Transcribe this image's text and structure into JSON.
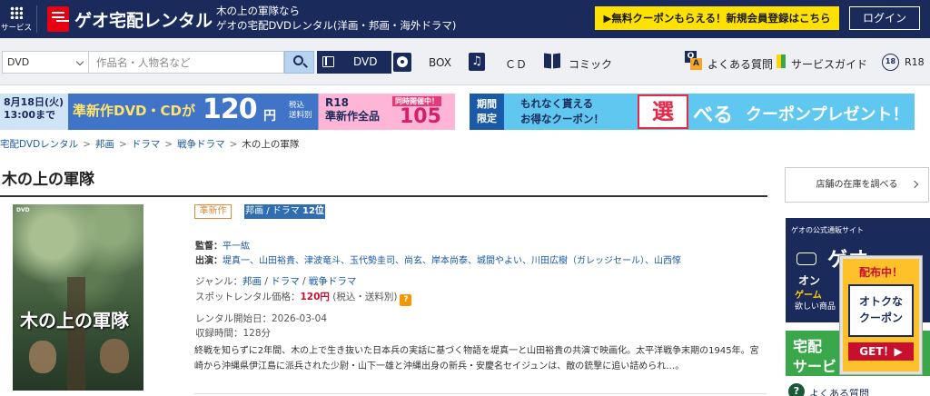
{
  "header": {
    "service_label": "サービス",
    "logo_text": "ゲオ宅配レンタル",
    "tagline_line1": "木の上の軍隊なら",
    "tagline_line2": "ゲオの宅配DVDレンタル(洋画・邦画・海外ドラマ)",
    "promo_label": "▶無料クーポンもらえる！新規会員登録はこちら",
    "login_label": "ログイン",
    "brand_color": "#1a2a5a",
    "promo_color": "#ffe100"
  },
  "nav": {
    "category_value": "DVD",
    "search_placeholder": "作品名・人物名など",
    "tabs": [
      {
        "label": "DVD",
        "icon": "film-icon",
        "active": true
      },
      {
        "label": "BOX",
        "icon": "disc-icon"
      },
      {
        "label": "ＣＤ",
        "icon": "music-note-icon"
      },
      {
        "label": "コミック",
        "icon": "book-icon"
      }
    ],
    "faq_label": "よくある質問",
    "guide_label": "サービスガイド",
    "r18_label": "R18",
    "r18_icon_text": "18"
  },
  "banner1": {
    "date_line1": "8月18日(火)",
    "date_line2": "13:00まで",
    "main_text": "準新作DVD・CDが",
    "price": "120",
    "yen": "円",
    "tax_line1": "税込",
    "tax_line2": "送料別",
    "simul_label": "同時開催中！",
    "r18_line1": "R18",
    "r18_line2": "準新作全品",
    "r18_price": "105円"
  },
  "banner2": {
    "limit_line1": "期間",
    "limit_line2": "限定",
    "text_line1": "もれなく貰える",
    "text_line2": "お得なクーポン！",
    "choose_char": "選",
    "beru": "べる",
    "cp_text": "クーポンプレゼント！"
  },
  "breadcrumb": {
    "items": [
      "宅配DVDレンタル",
      "邦画",
      "ドラマ",
      "戦争ドラマ"
    ],
    "current": "木の上の軍隊",
    "separator": ">"
  },
  "product": {
    "title": "木の上の軍隊",
    "poster_title": "木の上の軍隊",
    "poster_corner": "DVD",
    "badge_new": "準新作",
    "badge_rank_genre": "邦画 / ドラマ",
    "badge_rank_num": "12位",
    "director_label": "監督：",
    "director": "平一紘",
    "cast_label": "出演：",
    "cast": "堤真一、山田裕貴、津波竜斗、玉代勢圭司、尚玄、岸本尚泰、城間やよい、川田広樹（ガレッジセール）、山西惇",
    "genre_label": "ジャンル：",
    "genre_values": [
      "邦画",
      "ドラマ",
      "戦争ドラマ"
    ],
    "price_label": "スポットレンタル価格：",
    "price": "120円",
    "price_note": "(税込・送料別)",
    "help_icon_text": "?",
    "release_label": "レンタル開始日：",
    "release_date": "2026-03-04",
    "runtime_label": "収録時間：",
    "runtime": "128分",
    "synopsis": "終戦を知らずに2年間、木の上で生き抜いた日本兵の実話に基づく物語を堤真一と山田裕貴の共演で映画化。太平洋戦争末期の1945年。宮崎から沖縄県伊江島に派兵された少尉・山下一雄と沖縄出身の新兵・安慶名セイジュンは、敵の銃撃に追い詰められ…。"
  },
  "sidebar": {
    "stock_label": "店舗の在庫を調べる",
    "geo_ad_tag": "ゲオの公式通販サイト",
    "geo_ad_big": "ゲオ",
    "geo_ad_on": "オン",
    "geo_ad_game": "ゲーム",
    "geo_ad_game2": "欲しい商品",
    "coupon_top": "配布中！",
    "coupon_mid": "オトクな\nクーポン",
    "coupon_get": "GET！▶",
    "green_line1": "宅配",
    "green_line2": "サービ",
    "help_label": "よくある質問"
  }
}
